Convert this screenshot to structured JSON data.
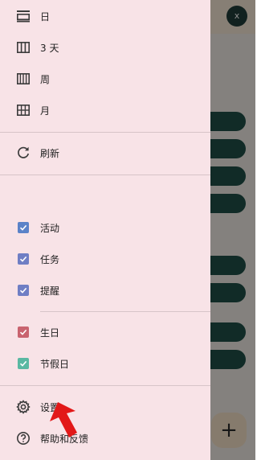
{
  "avatar": {
    "initial": "x"
  },
  "fab": {
    "icon": "plus-icon",
    "label": "+"
  },
  "drawer": {
    "view_items": [
      {
        "label": "日",
        "icon": "day-view-icon"
      },
      {
        "label": "3 天",
        "icon": "three-day-view-icon"
      },
      {
        "label": "周",
        "icon": "week-view-icon"
      },
      {
        "label": "月",
        "icon": "month-view-icon"
      }
    ],
    "refresh": {
      "label": "刷新",
      "icon": "refresh-icon"
    },
    "calendars_primary": [
      {
        "label": "活动",
        "checked": true,
        "color": "#5b82c8"
      },
      {
        "label": "任务",
        "checked": true,
        "color": "#6f7ec4"
      },
      {
        "label": "提醒",
        "checked": true,
        "color": "#6f7ec4"
      }
    ],
    "calendars_other": [
      {
        "label": "生日",
        "checked": true,
        "color": "#c9636f"
      },
      {
        "label": "节假日",
        "checked": true,
        "color": "#5ab8a2"
      }
    ],
    "settings": {
      "label": "设置",
      "icon": "gear-icon"
    },
    "help": {
      "label": "帮助和反馈",
      "icon": "help-icon"
    }
  },
  "colors": {
    "drawer_background": "#f8e3e7",
    "divider": "#d7c4c8",
    "pointer_arrow": "#e21818",
    "event_pill": "#1f4f48"
  }
}
